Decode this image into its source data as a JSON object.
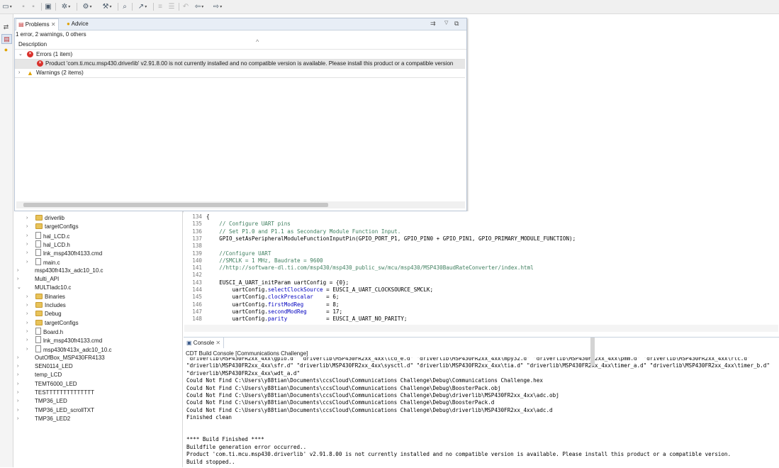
{
  "toolbar": {
    "items": [
      "new-icon",
      "save-icon",
      "save-all-icon",
      "terminal-icon",
      "build-icon",
      "debug-icon",
      "hammer-icon",
      "search-icon",
      "flash-icon",
      "toggle-icon",
      "annotation-icon",
      "back-icon",
      "forward-icon",
      "nav-back-icon",
      "nav-forward-icon"
    ]
  },
  "problems": {
    "tab_label": "Problems",
    "tab_close": "✕",
    "advice_label": "Advice",
    "summary": "1 error, 2 warnings, 0 others",
    "column_header": "Description",
    "sort_indicator": "^",
    "errors_group": "Errors (1 item)",
    "error_message": "Product 'com.ti.mcu.msp430.driverlib' v2.91.8.00 is not currently installed and no compatible version is available. Please install this product or a compatible version",
    "warnings_group": "Warnings (2 items)"
  },
  "explorer": {
    "items": [
      {
        "label": "driverlib",
        "type": "folder",
        "indent": 1
      },
      {
        "label": "targetConfigs",
        "type": "folder",
        "indent": 1
      },
      {
        "label": "hal_LCD.c",
        "type": "file",
        "indent": 1
      },
      {
        "label": "hal_LCD.h",
        "type": "file",
        "indent": 1
      },
      {
        "label": "lnk_msp430fr4133.cmd",
        "type": "file",
        "indent": 1
      },
      {
        "label": "main.c",
        "type": "file",
        "indent": 1
      },
      {
        "label": "msp430fr413x_adc10_10.c",
        "type": "project",
        "indent": 0
      },
      {
        "label": "Multi_API",
        "type": "project",
        "indent": 0
      },
      {
        "label": "MULTIadc10.c",
        "type": "project",
        "indent": 0,
        "expanded": true
      },
      {
        "label": "Binaries",
        "type": "folder",
        "indent": 1
      },
      {
        "label": "Includes",
        "type": "folder",
        "indent": 1
      },
      {
        "label": "Debug",
        "type": "folder",
        "indent": 1
      },
      {
        "label": "targetConfigs",
        "type": "folder",
        "indent": 1
      },
      {
        "label": "Board.h",
        "type": "file",
        "indent": 1
      },
      {
        "label": "lnk_msp430fr4133.cmd",
        "type": "file",
        "indent": 1
      },
      {
        "label": "msp430fr413x_adc10_10.c",
        "type": "file",
        "indent": 1
      },
      {
        "label": "OutOfBox_MSP430FR4133",
        "type": "project",
        "indent": 0
      },
      {
        "label": "SEN0114_LED",
        "type": "project",
        "indent": 0
      },
      {
        "label": "temp_LCD",
        "type": "project",
        "indent": 0
      },
      {
        "label": "TEMT6000_LED",
        "type": "project",
        "indent": 0
      },
      {
        "label": "TESTTTTTTTTTTTTTT",
        "type": "project",
        "indent": 0
      },
      {
        "label": "TMP36_LED",
        "type": "project",
        "indent": 0
      },
      {
        "label": "TMP36_LED_scrollTXT",
        "type": "project",
        "indent": 0
      },
      {
        "label": "TMP36_LED2",
        "type": "project",
        "indent": 0
      }
    ]
  },
  "editor": {
    "lines": [
      {
        "n": "134",
        "t": "{"
      },
      {
        "n": "135",
        "t": "    // Configure UART pins"
      },
      {
        "n": "136",
        "t": "    // Set P1.0 and P1.1 as Secondary Module Function Input."
      },
      {
        "n": "137",
        "t": "    GPIO_setAsPeripheralModuleFunctionInputPin(GPIO_PORT_P1, GPIO_PIN0 + GPIO_PIN1, GPIO_PRIMARY_MODULE_FUNCTION);"
      },
      {
        "n": "138",
        "t": ""
      },
      {
        "n": "139",
        "t": "    //Configure UART"
      },
      {
        "n": "140",
        "t": "    //SMCLK = 1 MHz, Baudrate = 9600"
      },
      {
        "n": "141",
        "t": "    //http://software-dl.ti.com/msp430/msp430_public_sw/mcu/msp430/MSP430BaudRateConverter/index.html"
      },
      {
        "n": "142",
        "t": ""
      },
      {
        "n": "143",
        "t": "    EUSCI_A_UART_initParam uartConfig = {0};"
      },
      {
        "n": "144",
        "t": "        uartConfig.selectClockSource = EUSCI_A_UART_CLOCKSOURCE_SMCLK;"
      },
      {
        "n": "145",
        "t": "        uartConfig.clockPrescalar    = 6;"
      },
      {
        "n": "146",
        "t": "        uartConfig.firstModReg       = 8;"
      },
      {
        "n": "147",
        "t": "        uartConfig.secondModReg      = 17;"
      },
      {
        "n": "148",
        "t": "        uartConfig.parity            = EUSCI_A_UART_NO_PARITY;"
      }
    ]
  },
  "console": {
    "tab_label": "Console",
    "tab_close": "✕",
    "title": "CDT Build Console [Communications Challenge]",
    "lines": [
      "\"driverlib\\MSP430FR2xx_4xx\\gpio.d\" \"driverlib\\MSP430FR2xx_4xx\\lcd_e.d\" \"driverlib\\MSP430FR2xx_4xx\\mpy32.d\" \"driverlib\\MSP430FR2xx_4xx\\pmm.d\" \"driverlib\\MSP430FR2xx_4xx\\rtc.d\"",
      "\"driverlib\\MSP430FR2xx_4xx\\sfr.d\" \"driverlib\\MSP430FR2xx_4xx\\sysctl.d\" \"driverlib\\MSP430FR2xx_4xx\\tia.d\" \"driverlib\\MSP430FR2xx_4xx\\timer_a.d\" \"driverlib\\MSP430FR2xx_4xx\\timer_b.d\"",
      "\"driverlib\\MSP430FR2xx_4xx\\wdt_a.d\"",
      "Could Not Find C:\\Users\\y88tian\\Documents\\ccsCloud\\Communications Challenge\\Debug\\Communications Challenge.hex",
      "Could Not Find C:\\Users\\y88tian\\Documents\\ccsCloud\\Communications Challenge\\Debug\\BoosterPack.obj",
      "Could Not Find C:\\Users\\y88tian\\Documents\\ccsCloud\\Communications Challenge\\Debug\\driverlib\\MSP430FR2xx_4xx\\adc.obj",
      "Could Not Find C:\\Users\\y88tian\\Documents\\ccsCloud\\Communications Challenge\\Debug\\BoosterPack.d",
      "Could Not Find C:\\Users\\y88tian\\Documents\\ccsCloud\\Communications Challenge\\Debug\\driverlib\\MSP430FR2xx_4xx\\adc.d",
      "Finished clean",
      "",
      "",
      "**** Build Finished ****",
      "Buildfile generation error occurred..",
      "Product 'com.ti.mcu.msp430.driverlib' v2.91.8.00 is not currently installed and no compatible version is available. Please install this product or a compatible version.",
      "Build stopped.."
    ]
  }
}
